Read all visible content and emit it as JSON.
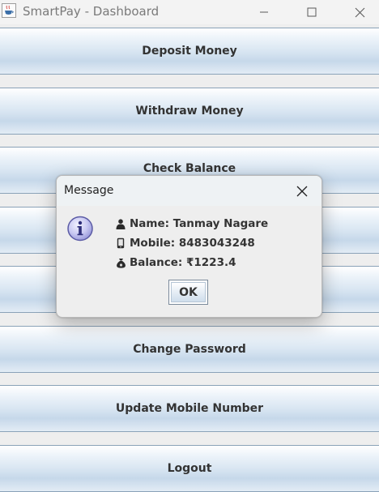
{
  "window": {
    "title": "SmartPay - Dashboard",
    "app_icon": "java-cup-icon",
    "controls": [
      "minimize-icon",
      "maximize-icon",
      "close-icon"
    ]
  },
  "dashboard": {
    "buttons": [
      {
        "label": "Deposit Money"
      },
      {
        "label": "Withdraw Money"
      },
      {
        "label": "Check Balance"
      },
      {
        "label": ""
      },
      {
        "label": ""
      },
      {
        "label": "Change Password"
      },
      {
        "label": "Update Mobile Number"
      },
      {
        "label": "Logout"
      }
    ]
  },
  "dialog": {
    "title": "Message",
    "icon": "info-icon",
    "lines": [
      {
        "icon": "person-icon",
        "text": "Name: Tanmay Nagare"
      },
      {
        "icon": "mobile-phone-icon",
        "text": "Mobile: 8483043248"
      },
      {
        "icon": "money-bag-icon",
        "text": "Balance: ₹1223.4"
      }
    ],
    "ok_label": "OK"
  },
  "colors": {
    "button_gradient_top": "#ffffff",
    "button_gradient_mid": "#d9e6f2",
    "button_border": "#8aa2b8",
    "dialog_background": "#eeeeee",
    "info_icon_fill": "#c9c9f2",
    "info_icon_border": "#5b5ba5"
  }
}
